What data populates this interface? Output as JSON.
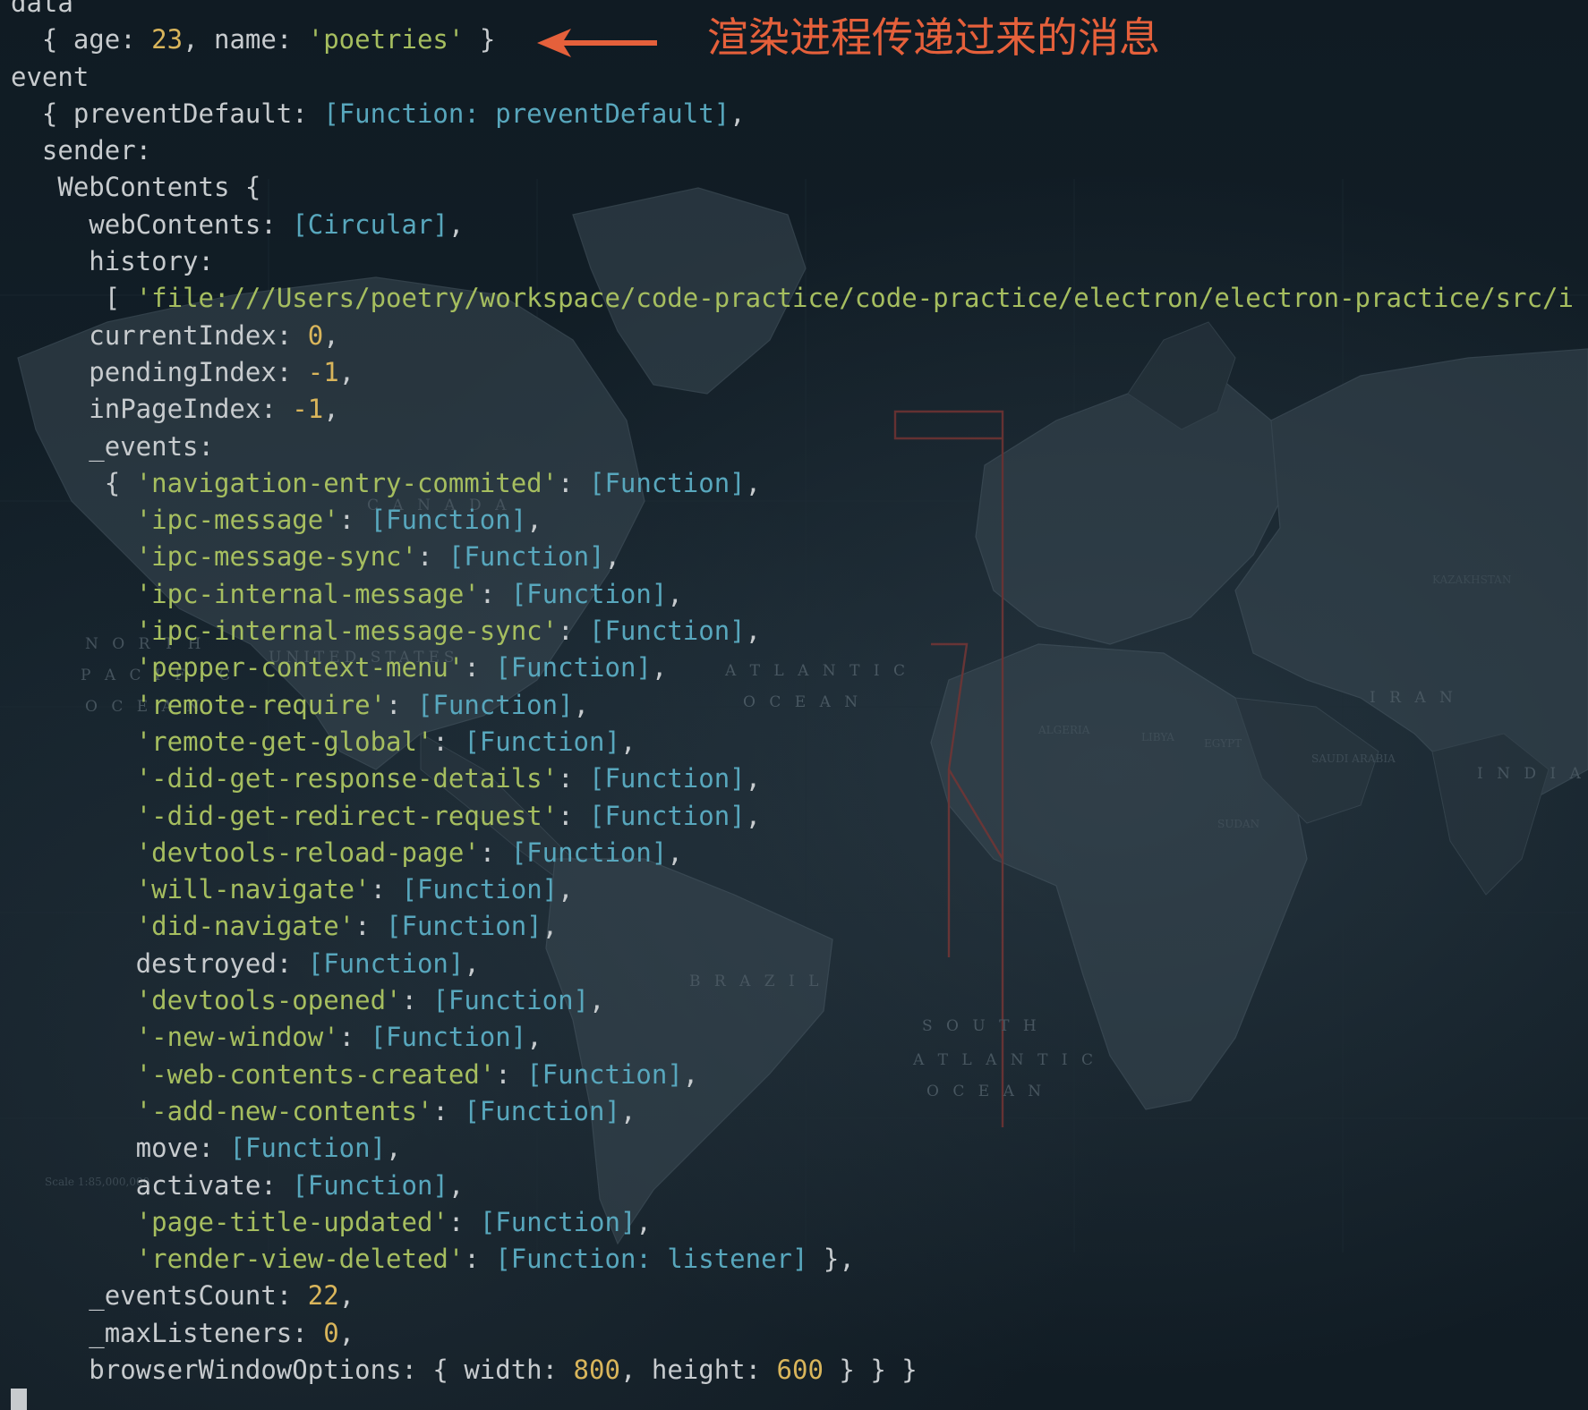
{
  "annotation": {
    "text": "渲染进程传递过来的消息",
    "color": "#e5603b"
  },
  "map_labels": {
    "canada": "C A N A D A",
    "united_states": "UNITED STATES",
    "brazil": "B R A Z I L",
    "iran": "I R A N",
    "india": "I N D I A",
    "north": "N O R T H",
    "pacific": "P A C I F I C",
    "ocean": "O C E A N",
    "atlantic": "A T L A N T I C",
    "south": "S O U T H",
    "algeria": "ALGERIA",
    "libya": "LIBYA",
    "egypt": "EGYPT",
    "sudan": "SUDAN",
    "saudi": "SAUDI ARABIA",
    "kazakhstan": "KAZAKHSTAN",
    "scale": "Scale 1:85,000,000"
  },
  "colors": {
    "background": "#0f1a22",
    "text": "#c7cbce",
    "number": "#d9b55b",
    "string": "#a6be5f",
    "function": "#58a7bd",
    "annotation": "#e5603b"
  },
  "lines": [
    [
      {
        "t": "data",
        "c": "key"
      }
    ],
    [
      {
        "t": "  { age: ",
        "c": "key"
      },
      {
        "t": "23",
        "c": "num"
      },
      {
        "t": ", name: ",
        "c": "key"
      },
      {
        "t": "'poetries'",
        "c": "str"
      },
      {
        "t": " }",
        "c": "punc"
      }
    ],
    [
      {
        "t": "event",
        "c": "key"
      }
    ],
    [
      {
        "t": "  { preventDefault: ",
        "c": "key"
      },
      {
        "t": "[Function: preventDefault]",
        "c": "func"
      },
      {
        "t": ",",
        "c": "punc"
      }
    ],
    [
      {
        "t": "  sender:",
        "c": "key"
      }
    ],
    [
      {
        "t": "   WebContents {",
        "c": "key"
      }
    ],
    [
      {
        "t": "     webContents: ",
        "c": "key"
      },
      {
        "t": "[Circular]",
        "c": "circ"
      },
      {
        "t": ",",
        "c": "punc"
      }
    ],
    [
      {
        "t": "     history:",
        "c": "key"
      }
    ],
    [
      {
        "t": "      [ ",
        "c": "punc"
      },
      {
        "t": "'file:///Users/poetry/workspace/code-practice/code-practice/electron/electron-practice/src/i",
        "c": "str"
      }
    ],
    [
      {
        "t": "     currentIndex: ",
        "c": "key"
      },
      {
        "t": "0",
        "c": "num"
      },
      {
        "t": ",",
        "c": "punc"
      }
    ],
    [
      {
        "t": "     pendingIndex: ",
        "c": "key"
      },
      {
        "t": "-1",
        "c": "num"
      },
      {
        "t": ",",
        "c": "punc"
      }
    ],
    [
      {
        "t": "     inPageIndex: ",
        "c": "key"
      },
      {
        "t": "-1",
        "c": "num"
      },
      {
        "t": ",",
        "c": "punc"
      }
    ],
    [
      {
        "t": "     _events:",
        "c": "key"
      }
    ],
    [
      {
        "t": "      { ",
        "c": "punc"
      },
      {
        "t": "'navigation-entry-commited'",
        "c": "str"
      },
      {
        "t": ": ",
        "c": "punc"
      },
      {
        "t": "[Function]",
        "c": "func"
      },
      {
        "t": ",",
        "c": "punc"
      }
    ],
    [
      {
        "t": "        ",
        "c": "punc"
      },
      {
        "t": "'ipc-message'",
        "c": "str"
      },
      {
        "t": ": ",
        "c": "punc"
      },
      {
        "t": "[Function]",
        "c": "func"
      },
      {
        "t": ",",
        "c": "punc"
      }
    ],
    [
      {
        "t": "        ",
        "c": "punc"
      },
      {
        "t": "'ipc-message-sync'",
        "c": "str"
      },
      {
        "t": ": ",
        "c": "punc"
      },
      {
        "t": "[Function]",
        "c": "func"
      },
      {
        "t": ",",
        "c": "punc"
      }
    ],
    [
      {
        "t": "        ",
        "c": "punc"
      },
      {
        "t": "'ipc-internal-message'",
        "c": "str"
      },
      {
        "t": ": ",
        "c": "punc"
      },
      {
        "t": "[Function]",
        "c": "func"
      },
      {
        "t": ",",
        "c": "punc"
      }
    ],
    [
      {
        "t": "        ",
        "c": "punc"
      },
      {
        "t": "'ipc-internal-message-sync'",
        "c": "str"
      },
      {
        "t": ": ",
        "c": "punc"
      },
      {
        "t": "[Function]",
        "c": "func"
      },
      {
        "t": ",",
        "c": "punc"
      }
    ],
    [
      {
        "t": "        ",
        "c": "punc"
      },
      {
        "t": "'pepper-context-menu'",
        "c": "str"
      },
      {
        "t": ": ",
        "c": "punc"
      },
      {
        "t": "[Function]",
        "c": "func"
      },
      {
        "t": ",",
        "c": "punc"
      }
    ],
    [
      {
        "t": "        ",
        "c": "punc"
      },
      {
        "t": "'remote-require'",
        "c": "str"
      },
      {
        "t": ": ",
        "c": "punc"
      },
      {
        "t": "[Function]",
        "c": "func"
      },
      {
        "t": ",",
        "c": "punc"
      }
    ],
    [
      {
        "t": "        ",
        "c": "punc"
      },
      {
        "t": "'remote-get-global'",
        "c": "str"
      },
      {
        "t": ": ",
        "c": "punc"
      },
      {
        "t": "[Function]",
        "c": "func"
      },
      {
        "t": ",",
        "c": "punc"
      }
    ],
    [
      {
        "t": "        ",
        "c": "punc"
      },
      {
        "t": "'-did-get-response-details'",
        "c": "str"
      },
      {
        "t": ": ",
        "c": "punc"
      },
      {
        "t": "[Function]",
        "c": "func"
      },
      {
        "t": ",",
        "c": "punc"
      }
    ],
    [
      {
        "t": "        ",
        "c": "punc"
      },
      {
        "t": "'-did-get-redirect-request'",
        "c": "str"
      },
      {
        "t": ": ",
        "c": "punc"
      },
      {
        "t": "[Function]",
        "c": "func"
      },
      {
        "t": ",",
        "c": "punc"
      }
    ],
    [
      {
        "t": "        ",
        "c": "punc"
      },
      {
        "t": "'devtools-reload-page'",
        "c": "str"
      },
      {
        "t": ": ",
        "c": "punc"
      },
      {
        "t": "[Function]",
        "c": "func"
      },
      {
        "t": ",",
        "c": "punc"
      }
    ],
    [
      {
        "t": "        ",
        "c": "punc"
      },
      {
        "t": "'will-navigate'",
        "c": "str"
      },
      {
        "t": ": ",
        "c": "punc"
      },
      {
        "t": "[Function]",
        "c": "func"
      },
      {
        "t": ",",
        "c": "punc"
      }
    ],
    [
      {
        "t": "        ",
        "c": "punc"
      },
      {
        "t": "'did-navigate'",
        "c": "str"
      },
      {
        "t": ": ",
        "c": "punc"
      },
      {
        "t": "[Function]",
        "c": "func"
      },
      {
        "t": ",",
        "c": "punc"
      }
    ],
    [
      {
        "t": "        destroyed: ",
        "c": "key"
      },
      {
        "t": "[Function]",
        "c": "func"
      },
      {
        "t": ",",
        "c": "punc"
      }
    ],
    [
      {
        "t": "        ",
        "c": "punc"
      },
      {
        "t": "'devtools-opened'",
        "c": "str"
      },
      {
        "t": ": ",
        "c": "punc"
      },
      {
        "t": "[Function]",
        "c": "func"
      },
      {
        "t": ",",
        "c": "punc"
      }
    ],
    [
      {
        "t": "        ",
        "c": "punc"
      },
      {
        "t": "'-new-window'",
        "c": "str"
      },
      {
        "t": ": ",
        "c": "punc"
      },
      {
        "t": "[Function]",
        "c": "func"
      },
      {
        "t": ",",
        "c": "punc"
      }
    ],
    [
      {
        "t": "        ",
        "c": "punc"
      },
      {
        "t": "'-web-contents-created'",
        "c": "str"
      },
      {
        "t": ": ",
        "c": "punc"
      },
      {
        "t": "[Function]",
        "c": "func"
      },
      {
        "t": ",",
        "c": "punc"
      }
    ],
    [
      {
        "t": "        ",
        "c": "punc"
      },
      {
        "t": "'-add-new-contents'",
        "c": "str"
      },
      {
        "t": ": ",
        "c": "punc"
      },
      {
        "t": "[Function]",
        "c": "func"
      },
      {
        "t": ",",
        "c": "punc"
      }
    ],
    [
      {
        "t": "        move: ",
        "c": "key"
      },
      {
        "t": "[Function]",
        "c": "func"
      },
      {
        "t": ",",
        "c": "punc"
      }
    ],
    [
      {
        "t": "        activate: ",
        "c": "key"
      },
      {
        "t": "[Function]",
        "c": "func"
      },
      {
        "t": ",",
        "c": "punc"
      }
    ],
    [
      {
        "t": "        ",
        "c": "punc"
      },
      {
        "t": "'page-title-updated'",
        "c": "str"
      },
      {
        "t": ": ",
        "c": "punc"
      },
      {
        "t": "[Function]",
        "c": "func"
      },
      {
        "t": ",",
        "c": "punc"
      }
    ],
    [
      {
        "t": "        ",
        "c": "punc"
      },
      {
        "t": "'render-view-deleted'",
        "c": "str"
      },
      {
        "t": ": ",
        "c": "punc"
      },
      {
        "t": "[Function: listener]",
        "c": "func"
      },
      {
        "t": " },",
        "c": "punc"
      }
    ],
    [
      {
        "t": "     _eventsCount: ",
        "c": "key"
      },
      {
        "t": "22",
        "c": "num"
      },
      {
        "t": ",",
        "c": "punc"
      }
    ],
    [
      {
        "t": "     _maxListeners: ",
        "c": "key"
      },
      {
        "t": "0",
        "c": "num"
      },
      {
        "t": ",",
        "c": "punc"
      }
    ],
    [
      {
        "t": "     browserWindowOptions: { width: ",
        "c": "key"
      },
      {
        "t": "800",
        "c": "num"
      },
      {
        "t": ", height: ",
        "c": "key"
      },
      {
        "t": "600",
        "c": "num"
      },
      {
        "t": " } } }",
        "c": "punc"
      }
    ]
  ]
}
